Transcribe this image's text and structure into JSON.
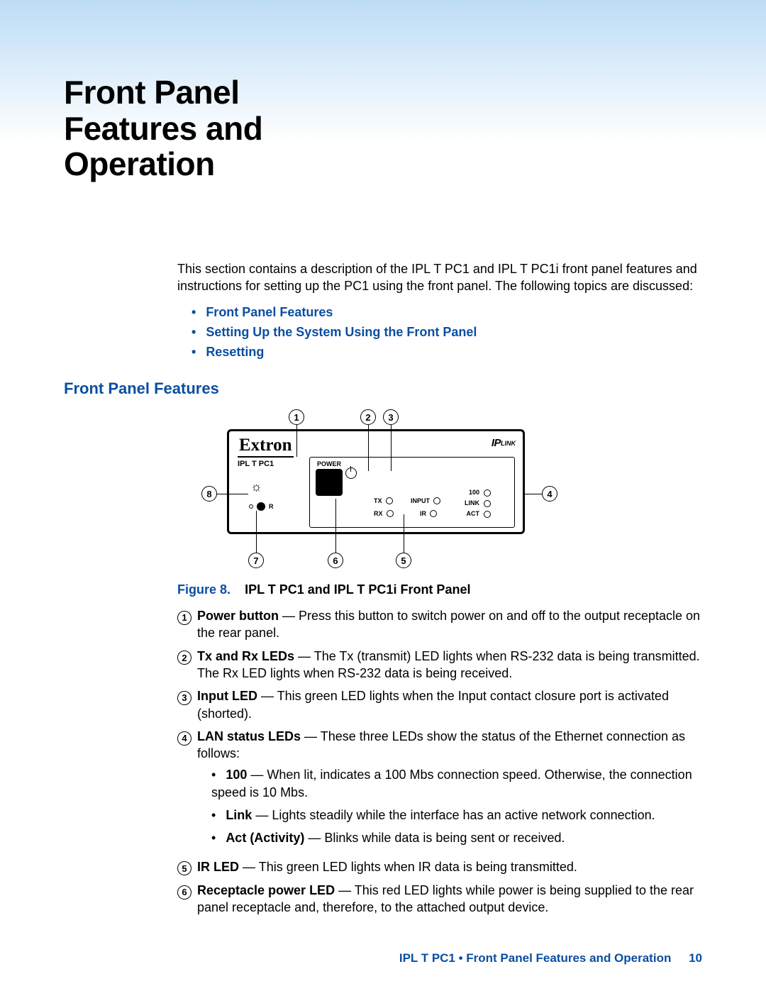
{
  "title": "Front Panel Features and Operation",
  "intro": "This section contains a description of the IPL T PC1 and IPL T PC1i front panel features and instructions for setting up the PC1 using the front panel. The following topics are discussed:",
  "topics": [
    "Front Panel Features",
    "Setting Up the System Using the Front Panel",
    "Resetting"
  ],
  "section_heading": "Front Panel Features",
  "figure": {
    "label": "Figure 8.",
    "caption": "IPL T PC1 and IPL T PC1i Front Panel"
  },
  "diagram": {
    "brand": "Extron",
    "model": "IPL T PC1",
    "power_label": "POWER",
    "tx": "TX",
    "rx": "RX",
    "input": "INPUT",
    "ir": "IR",
    "lan_100": "100",
    "lan_link": "LINK",
    "lan_act": "ACT",
    "reset": "R",
    "iplink_ip": "IP",
    "iplink_link": "LINK",
    "callouts": [
      "1",
      "2",
      "3",
      "4",
      "5",
      "6",
      "7",
      "8"
    ]
  },
  "features": [
    {
      "n": "1",
      "term": "Power button",
      "text": " — Press this button to switch power on and off to the output receptacle on the rear panel."
    },
    {
      "n": "2",
      "term": "Tx and Rx LEDs",
      "text": " — The Tx (transmit) LED lights when RS-232 data is being transmitted. The Rx LED lights when RS-232 data is being received."
    },
    {
      "n": "3",
      "term": "Input LED",
      "text": " — This green LED lights when the Input contact closure port is activated (shorted)."
    },
    {
      "n": "4",
      "term": "LAN status LEDs",
      "text": " — These three LEDs show the status of the Ethernet connection as follows:",
      "subs": [
        {
          "term": "100",
          "text": " — When lit, indicates a 100 Mbs connection speed. Otherwise, the connection speed is 10 Mbs."
        },
        {
          "term": "Link",
          "text": " — Lights steadily while the interface has an active network connection."
        },
        {
          "term": "Act (Activity)",
          "text": " — Blinks while data is being sent or received."
        }
      ]
    },
    {
      "n": "5",
      "term": "IR LED",
      "text": " — This green LED lights when IR data is being transmitted."
    },
    {
      "n": "6",
      "term": "Receptacle power LED",
      "text": " — This red LED lights while power is being supplied to the rear panel receptacle and, therefore, to the attached output device."
    }
  ],
  "footer": {
    "product": "IPL T PC1 • Front Panel Features and Operation",
    "page": "10"
  }
}
